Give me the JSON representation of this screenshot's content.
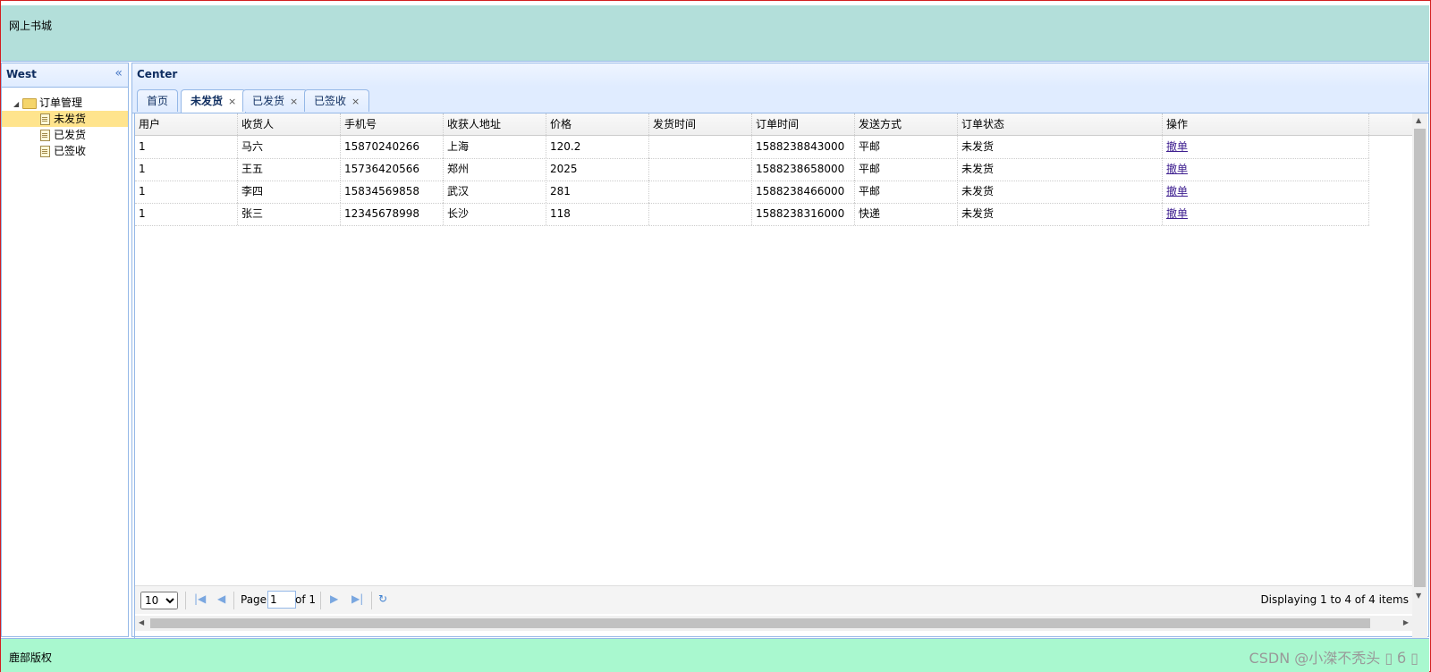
{
  "north": {
    "title": "网上书城"
  },
  "south": {
    "copyright": "鹿部版权",
    "watermark": "CSDN @小滐不秃头 ▯ б ▯"
  },
  "west": {
    "title": "West",
    "tree": {
      "root": "订单管理",
      "items": [
        "未发货",
        "已发货",
        "已签收"
      ],
      "selected": "未发货"
    }
  },
  "center": {
    "title": "Center",
    "tabs": [
      {
        "label": "首页",
        "closable": false
      },
      {
        "label": "未发货",
        "closable": true,
        "active": true
      },
      {
        "label": "已发货",
        "closable": true
      },
      {
        "label": "已签收",
        "closable": true
      }
    ],
    "close_glyph": "×",
    "grid": {
      "columns": [
        "用户",
        "收货人",
        "手机号",
        "收获人地址",
        "价格",
        "发货时间",
        "订单时间",
        "发送方式",
        "订单状态",
        "操作"
      ],
      "rows": [
        [
          "1",
          "马六",
          "15870240266",
          "上海",
          "120.2",
          "",
          "1588238843000",
          "平邮",
          "未发货",
          "撤单"
        ],
        [
          "1",
          "王五",
          "15736420566",
          "郑州",
          "2025",
          "",
          "1588238658000",
          "平邮",
          "未发货",
          "撤单"
        ],
        [
          "1",
          "李四",
          "15834569858",
          "武汉",
          "281",
          "",
          "1588238466000",
          "平邮",
          "未发货",
          "撤单"
        ],
        [
          "1",
          "张三",
          "12345678998",
          "长沙",
          "118",
          "",
          "1588238316000",
          "快递",
          "未发货",
          "撤单"
        ]
      ]
    },
    "pager": {
      "page_size": "10",
      "page_label": "Page",
      "page_value": "1",
      "of_label": "of 1",
      "info": "Displaying 1 to 4 of 4 items"
    }
  }
}
